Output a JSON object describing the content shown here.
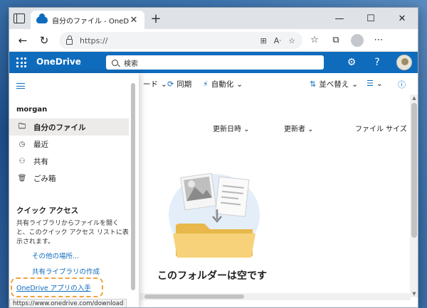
{
  "browser": {
    "tab_title": "自分のファイル - OneDrive",
    "url": "https://",
    "new_tab": "+",
    "status_url": "https://www.onedrive.com/download"
  },
  "app": {
    "name": "OneDrive",
    "search_placeholder": "検索"
  },
  "commandbar": {
    "partial_item": "ード",
    "sync": "同期",
    "automate": "自動化",
    "sort": "並べ替え"
  },
  "columns": {
    "modified": "更新日時",
    "modified_by": "更新者",
    "file_size": "ファイル サイズ"
  },
  "empty_state": {
    "title": "このフォルダーは空です"
  },
  "nav": {
    "user": "morgan",
    "items": [
      {
        "label": "自分のファイル",
        "icon": "folder-icon",
        "active": true
      },
      {
        "label": "最近",
        "icon": "clock-icon",
        "active": false
      },
      {
        "label": "共有",
        "icon": "people-icon",
        "active": false
      },
      {
        "label": "ごみ箱",
        "icon": "trash-icon",
        "active": false
      }
    ],
    "quick_access_title": "クイック アクセス",
    "quick_access_desc": "共有ライブラリからファイルを開くと、このクイック アクセス リストに表示されます。",
    "more_places": "その他の場所...",
    "create_library": "共有ライブラリの作成",
    "get_app": "OneDrive アプリの入手"
  },
  "colors": {
    "accent": "#0f6cbd",
    "highlight": "#f2a33a"
  }
}
